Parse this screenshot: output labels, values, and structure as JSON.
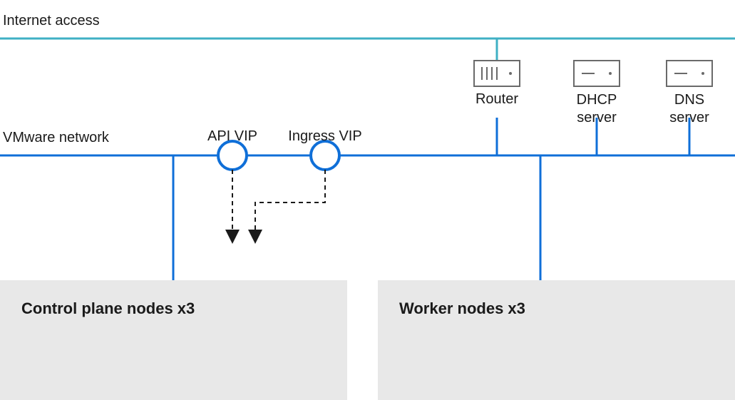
{
  "labels": {
    "internet": "Internet access",
    "vmware": "VMware network",
    "api_vip": "API VIP",
    "ingress_vip": "Ingress VIP",
    "router": "Router",
    "dhcp": "DHCP\nserver",
    "dns": "DNS\nserver",
    "control_plane": "Control plane nodes  x3",
    "worker": "Worker nodes  x3"
  },
  "colors": {
    "internet_line": "#3fb0c4",
    "net_line": "#0f6fd8",
    "box_fill": "#e8e8e8",
    "icon_stroke": "#6a6a6a",
    "dash": "#1a1a1a"
  }
}
